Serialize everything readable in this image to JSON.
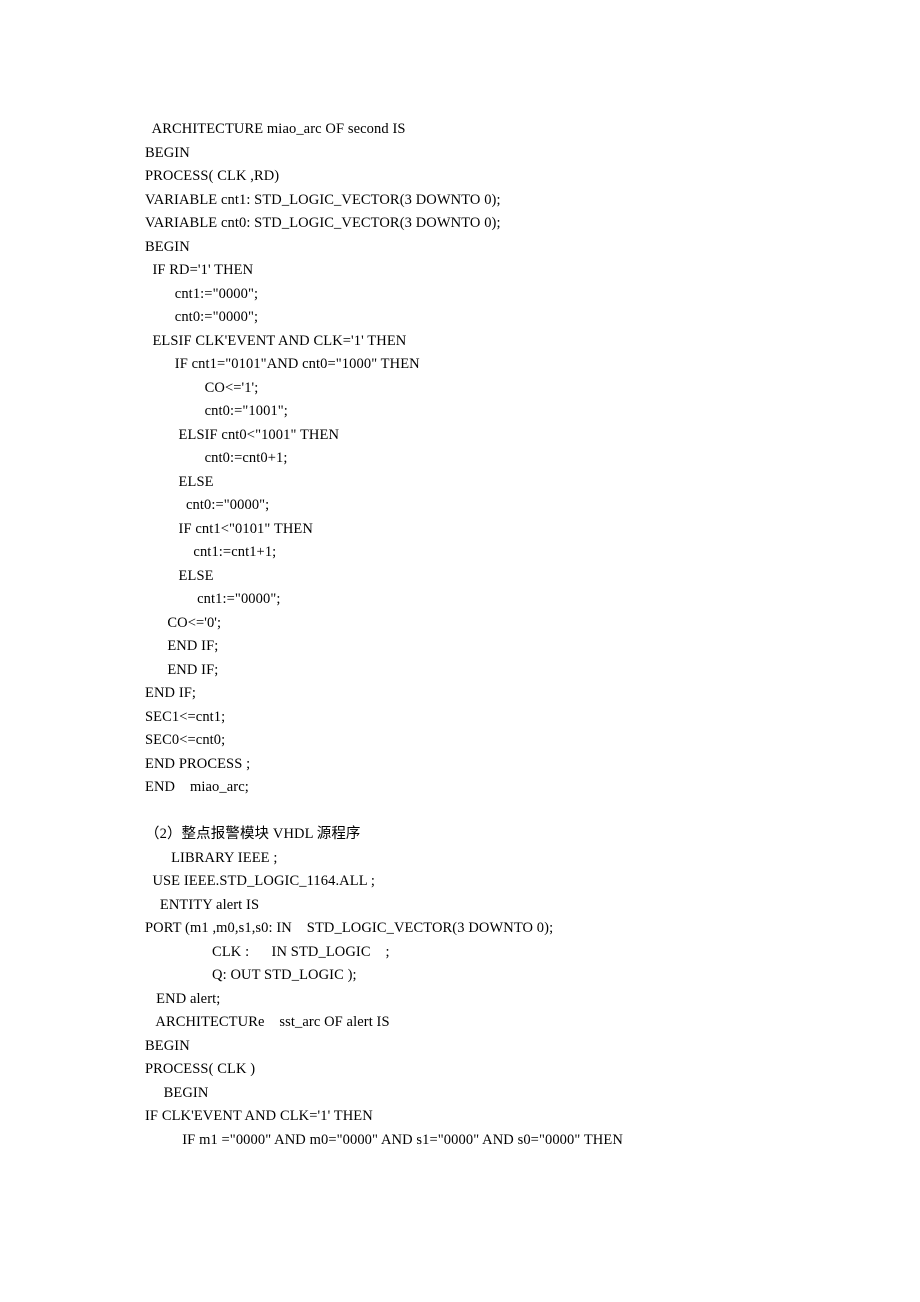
{
  "lines": [
    "  ARCHITECTURE miao_arc OF second IS",
    "BEGIN",
    "PROCESS( CLK ,RD)",
    "VARIABLE cnt1: STD_LOGIC_VECTOR(3 DOWNTO 0);",
    "VARIABLE cnt0: STD_LOGIC_VECTOR(3 DOWNTO 0);",
    "BEGIN",
    "  IF RD='1' THEN",
    "        cnt1:=\"0000\";",
    "        cnt0:=\"0000\";",
    "  ELSIF CLK'EVENT AND CLK='1' THEN",
    "        IF cnt1=\"0101\"AND cnt0=\"1000\" THEN",
    "                CO<='1';",
    "                cnt0:=\"1001\";",
    "         ELSIF cnt0<\"1001\" THEN",
    "                cnt0:=cnt0+1;",
    "         ELSE",
    "           cnt0:=\"0000\";",
    "         IF cnt1<\"0101\" THEN",
    "             cnt1:=cnt1+1;",
    "         ELSE",
    "              cnt1:=\"0000\";",
    "      CO<='0';",
    "      END IF;",
    "      END IF;",
    "END IF;",
    "SEC1<=cnt1;",
    "SEC0<=cnt0;",
    "END PROCESS ;",
    "END    miao_arc;",
    "",
    "（2）整点报警模块 VHDL 源程序",
    "       LIBRARY IEEE ;",
    "  USE IEEE.STD_LOGIC_1164.ALL ;",
    "    ENTITY alert IS",
    "PORT (m1 ,m0,s1,s0: IN    STD_LOGIC_VECTOR(3 DOWNTO 0);",
    "                  CLK :      IN STD_LOGIC    ;",
    "                  Q: OUT STD_LOGIC );",
    "   END alert;",
    "   ARCHITECTURe    sst_arc OF alert IS",
    "BEGIN",
    "PROCESS( CLK )",
    "     BEGIN",
    "IF CLK'EVENT AND CLK='1' THEN",
    "          IF m1 =\"0000\" AND m0=\"0000\" AND s1=\"0000\" AND s0=\"0000\" THEN"
  ]
}
